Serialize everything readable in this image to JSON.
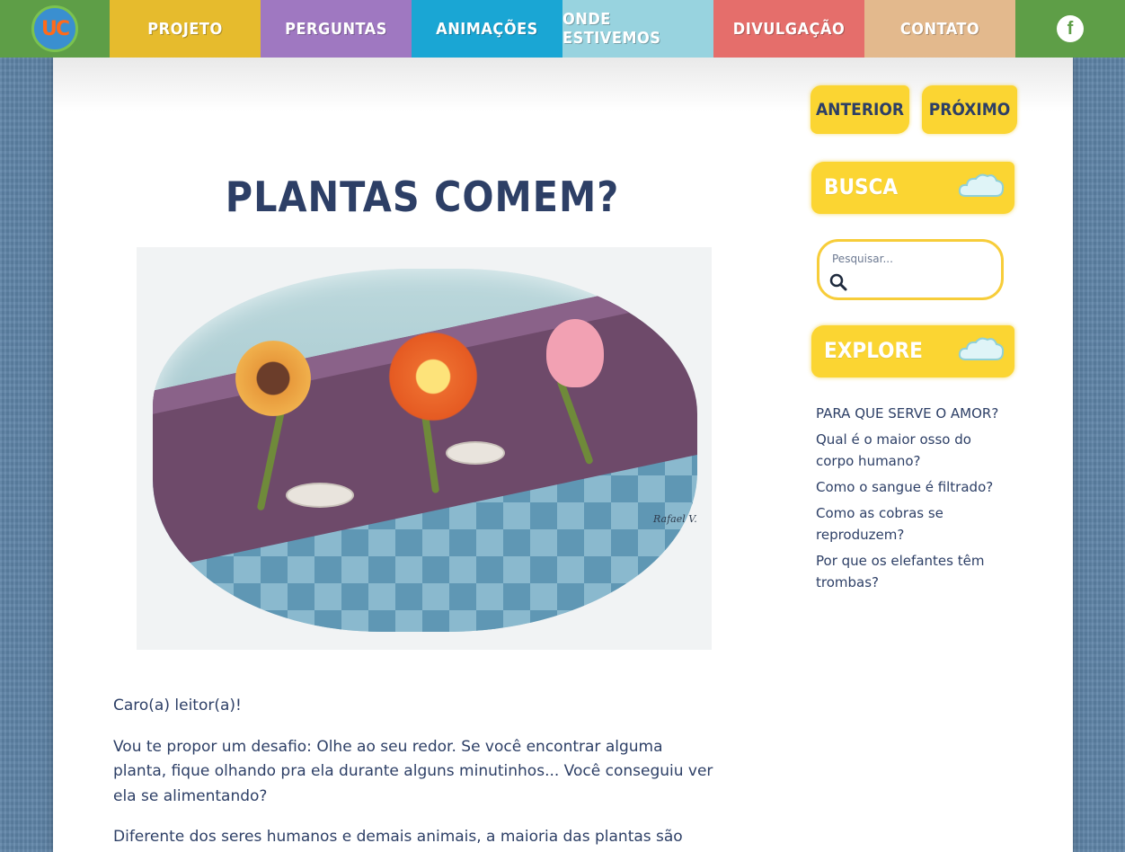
{
  "nav": {
    "logo_text": "UC",
    "items": [
      {
        "label": "PROJETO",
        "color": "#e6bb2d"
      },
      {
        "label": "PERGUNTAS",
        "color": "#9f78c1"
      },
      {
        "label": "ANIMAÇÕES",
        "color": "#1aa6d4"
      },
      {
        "label": "ONDE ESTIVEMOS",
        "color": "#98d3df"
      },
      {
        "label": "DIVULGAÇÃO",
        "color": "#e56e6b"
      },
      {
        "label": "CONTATO",
        "color": "#e3b98d"
      }
    ],
    "facebook_icon": "facebook-icon"
  },
  "article": {
    "title": "PLANTAS COMEM?",
    "illustration_signature": "Rafael V.",
    "paragraphs": [
      "Caro(a) leitor(a)!",
      "Vou te propor um desafio: Olhe ao seu redor. Se você encontrar alguma planta, fique olhando pra ela durante alguns minutinhos... Você conseguiu ver ela se alimentando?",
      " Diferente dos seres humanos e demais animais, a maioria das plantas são"
    ]
  },
  "sidebar": {
    "prev_label": "ANTERIOR",
    "next_label": "PRÓXIMO",
    "search_heading": "BUSCA",
    "search_placeholder": "Pesquisar...",
    "explore_heading": "EXPLORE",
    "explore_links": [
      "PARA QUE SERVE O AMOR?",
      "Qual é o maior osso do corpo humano?",
      "Como o sangue é filtrado?",
      "Como as cobras se reproduzem?",
      "Por que os elefantes têm trombas?"
    ]
  }
}
